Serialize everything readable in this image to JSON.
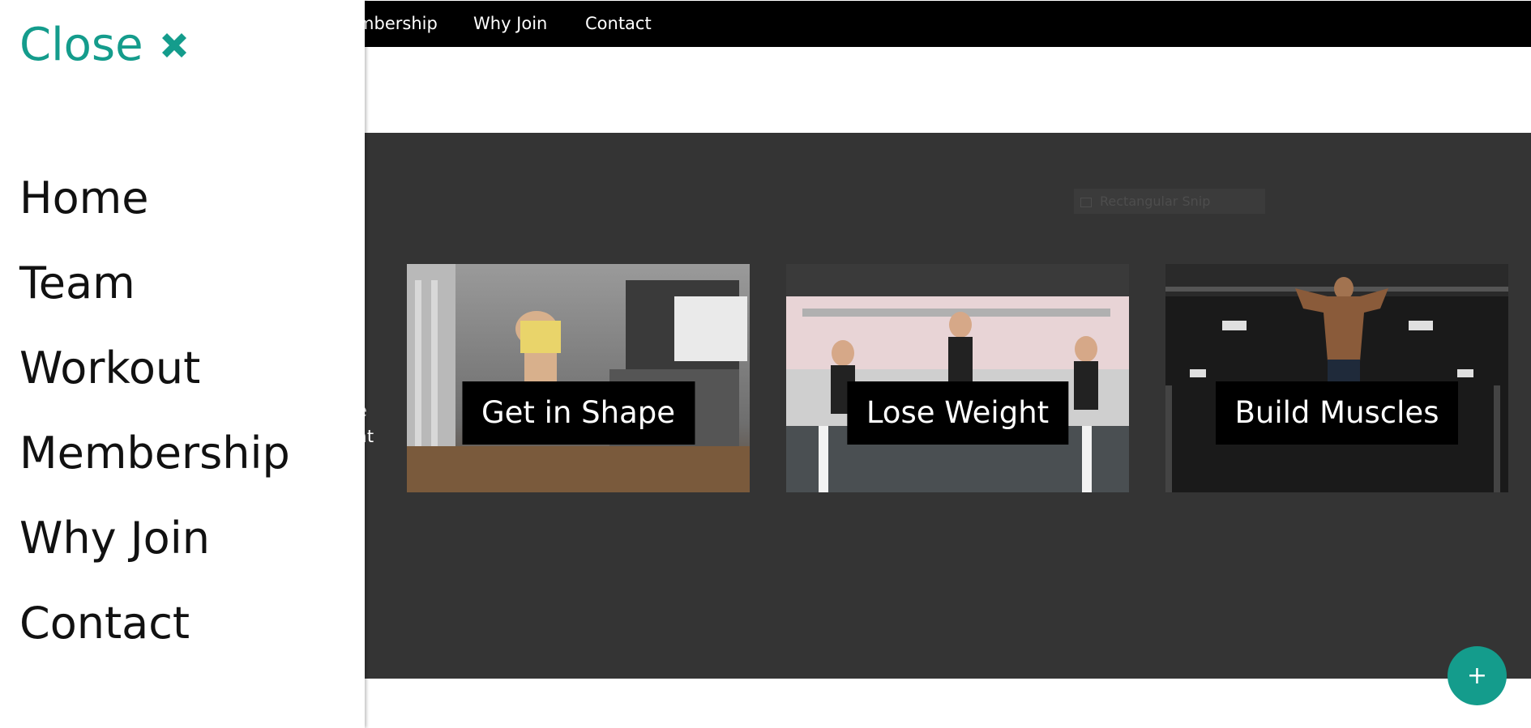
{
  "topnav": {
    "items": [
      "Membership",
      "Why Join",
      "Contact"
    ]
  },
  "sidenav": {
    "close_label": "Close",
    "items": [
      "Home",
      "Team",
      "Workout",
      "Membership",
      "Why Join",
      "Contact"
    ]
  },
  "banner": {
    "snip_tooltip": "Rectangular Snip",
    "peek_lines": [
      "e",
      "at"
    ]
  },
  "cards": [
    {
      "caption": "Get in Shape",
      "photo": "woman-cable-workout-photo"
    },
    {
      "caption": "Lose Weight",
      "photo": "spin-class-photo"
    },
    {
      "caption": "Build Muscles",
      "photo": "pull-up-back-photo"
    }
  ],
  "fab": {
    "label": "+"
  },
  "colors": {
    "accent": "#149c8c",
    "navbar": "#000000",
    "dark_section": "#343434",
    "sidenav": "#ffffff"
  }
}
